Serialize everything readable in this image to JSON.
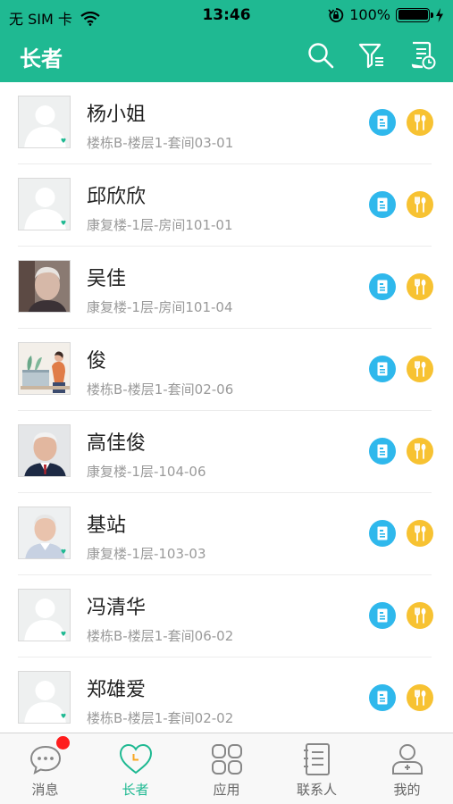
{
  "status_bar": {
    "carrier": "无 SIM 卡",
    "time": "13:46",
    "battery": "100%"
  },
  "header": {
    "title": "长者"
  },
  "elders": [
    {
      "name": "杨小姐",
      "location": "楼栋B-楼层1-套间03-01",
      "avatar": "placeholder"
    },
    {
      "name": "邱欣欣",
      "location": "康复楼-1层-房间101-01",
      "avatar": "placeholder"
    },
    {
      "name": "吴佳",
      "location": "康复楼-1层-房间101-04",
      "avatar": "photo"
    },
    {
      "name": "俊",
      "location": "楼栋B-楼层1-套间02-06",
      "avatar": "illustration"
    },
    {
      "name": "高佳俊",
      "location": "康复楼-1层-104-06",
      "avatar": "photo"
    },
    {
      "name": "基站",
      "location": "康复楼-1层-103-03",
      "avatar": "photo"
    },
    {
      "name": "冯清华",
      "location": "楼栋B-楼层1-套间06-02",
      "avatar": "placeholder"
    },
    {
      "name": "郑雄爱",
      "location": "楼栋B-楼层1-套间02-02",
      "avatar": "placeholder"
    }
  ],
  "tabs": [
    {
      "label": "消息",
      "icon": "chat-bubble-icon",
      "active": false,
      "badge": true
    },
    {
      "label": "长者",
      "icon": "heart-icon",
      "active": true,
      "badge": false
    },
    {
      "label": "应用",
      "icon": "apps-grid-icon",
      "active": false,
      "badge": false
    },
    {
      "label": "联系人",
      "icon": "contacts-book-icon",
      "active": false,
      "badge": false
    },
    {
      "label": "我的",
      "icon": "user-icon",
      "active": false,
      "badge": false
    }
  ],
  "colors": {
    "brand": "#1fb992",
    "info_badge": "#2fb8ec",
    "meal_badge": "#f7c232",
    "notification_dot": "#ff1d1d"
  }
}
